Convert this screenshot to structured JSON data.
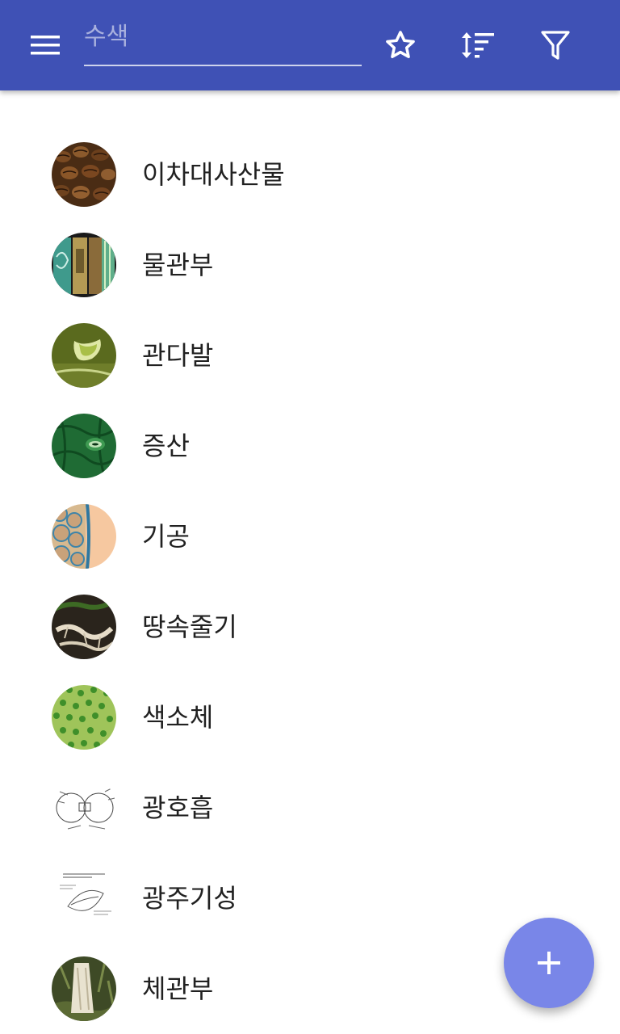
{
  "app_bar": {
    "background": "#3f51b5",
    "menu_icon": "hamburger-menu-icon",
    "search": {
      "value": "",
      "placeholder": "수색"
    },
    "actions": [
      {
        "icon": "star-outline-icon"
      },
      {
        "icon": "sort-icon"
      },
      {
        "icon": "filter-icon"
      }
    ]
  },
  "items": [
    {
      "label": "이차대사산물",
      "thumbnail": "coffee-beans-photo"
    },
    {
      "label": "물관부",
      "thumbnail": "xylem-micrograph"
    },
    {
      "label": "관다발",
      "thumbnail": "vascular-bundle-photo"
    },
    {
      "label": "증산",
      "thumbnail": "leaf-stoma-photo"
    },
    {
      "label": "기공",
      "thumbnail": "stomata-micrograph"
    },
    {
      "label": "땅속줄기",
      "thumbnail": "rhizome-photo"
    },
    {
      "label": "색소체",
      "thumbnail": "chloroplast-micrograph"
    },
    {
      "label": "광호흡",
      "thumbnail": "photorespiration-diagram"
    },
    {
      "label": "광주기성",
      "thumbnail": "photoperiodism-diagram"
    },
    {
      "label": "체관부",
      "thumbnail": "phloem-photo"
    }
  ],
  "fab": {
    "icon": "plus-icon",
    "color": "#7986e8"
  }
}
